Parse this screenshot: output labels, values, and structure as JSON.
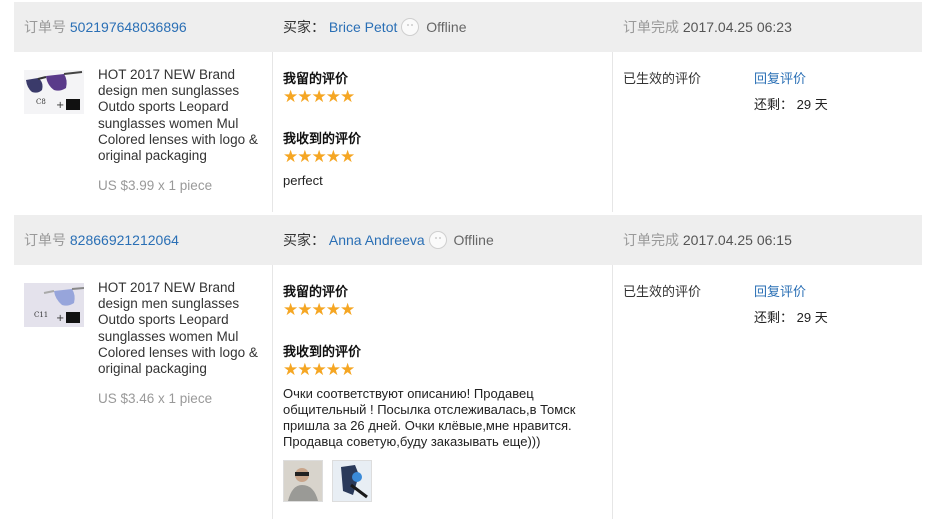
{
  "labels": {
    "order_no": "订单号",
    "buyer": "买家：",
    "completed": "订单完成",
    "offline": "Offline",
    "my_review": "我留的评价",
    "received_review": "我收到的评价",
    "status": "已生效的评价",
    "reply": "回复评价",
    "remain_prefix": "还剩：",
    "remain_suffix": "天"
  },
  "orders": [
    {
      "order_id": "502197648036896",
      "buyer_name": "Brice Petot",
      "completed_at": "2017.04.25 06:23",
      "product_title": "HOT 2017 NEW Brand design men sunglasses Outdo sports Leopard sunglasses women Mul Colored lenses with logo & original packaging",
      "price": "US $3.99 x 1 piece",
      "thumb_label": "C8",
      "my_stars": "★★★★★",
      "received_stars": "★★★★★",
      "feedback_text": "perfect",
      "days_remaining": "29"
    },
    {
      "order_id": "82866921212064",
      "buyer_name": "Anna Andreeva",
      "completed_at": "2017.04.25 06:15",
      "product_title": "HOT 2017 NEW Brand design men sunglasses Outdo sports Leopard sunglasses women Mul Colored lenses with logo & original packaging",
      "price": "US $3.46 x 1 piece",
      "thumb_label": "C11",
      "my_stars": "★★★★★",
      "received_stars": "★★★★★",
      "feedback_text": "Очки соответствуют описанию! Продавец общительный ! Посылка отслеживалась,в Томск пришла за 26 дней. Очки клёвые,мне нравится. Продавца советую,буду заказывать еще)))",
      "days_remaining": "29"
    }
  ],
  "colors": {
    "star": "#f5a623",
    "link": "#2a6fb5",
    "header_bg": "#eeeeee"
  }
}
